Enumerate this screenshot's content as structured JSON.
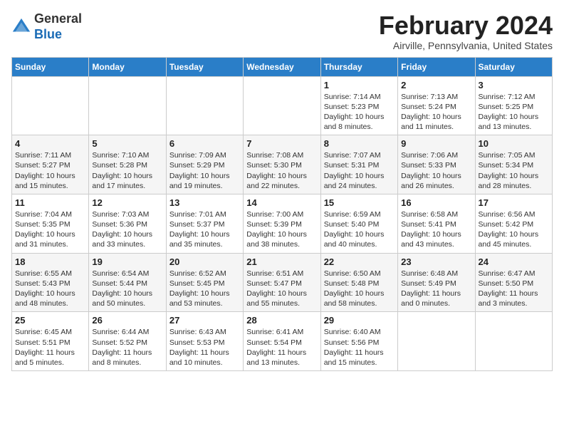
{
  "header": {
    "logo_line1": "General",
    "logo_line2": "Blue",
    "month": "February 2024",
    "location": "Airville, Pennsylvania, United States"
  },
  "weekdays": [
    "Sunday",
    "Monday",
    "Tuesday",
    "Wednesday",
    "Thursday",
    "Friday",
    "Saturday"
  ],
  "weeks": [
    [
      {
        "day": "",
        "info": ""
      },
      {
        "day": "",
        "info": ""
      },
      {
        "day": "",
        "info": ""
      },
      {
        "day": "",
        "info": ""
      },
      {
        "day": "1",
        "info": "Sunrise: 7:14 AM\nSunset: 5:23 PM\nDaylight: 10 hours\nand 8 minutes."
      },
      {
        "day": "2",
        "info": "Sunrise: 7:13 AM\nSunset: 5:24 PM\nDaylight: 10 hours\nand 11 minutes."
      },
      {
        "day": "3",
        "info": "Sunrise: 7:12 AM\nSunset: 5:25 PM\nDaylight: 10 hours\nand 13 minutes."
      }
    ],
    [
      {
        "day": "4",
        "info": "Sunrise: 7:11 AM\nSunset: 5:27 PM\nDaylight: 10 hours\nand 15 minutes."
      },
      {
        "day": "5",
        "info": "Sunrise: 7:10 AM\nSunset: 5:28 PM\nDaylight: 10 hours\nand 17 minutes."
      },
      {
        "day": "6",
        "info": "Sunrise: 7:09 AM\nSunset: 5:29 PM\nDaylight: 10 hours\nand 19 minutes."
      },
      {
        "day": "7",
        "info": "Sunrise: 7:08 AM\nSunset: 5:30 PM\nDaylight: 10 hours\nand 22 minutes."
      },
      {
        "day": "8",
        "info": "Sunrise: 7:07 AM\nSunset: 5:31 PM\nDaylight: 10 hours\nand 24 minutes."
      },
      {
        "day": "9",
        "info": "Sunrise: 7:06 AM\nSunset: 5:33 PM\nDaylight: 10 hours\nand 26 minutes."
      },
      {
        "day": "10",
        "info": "Sunrise: 7:05 AM\nSunset: 5:34 PM\nDaylight: 10 hours\nand 28 minutes."
      }
    ],
    [
      {
        "day": "11",
        "info": "Sunrise: 7:04 AM\nSunset: 5:35 PM\nDaylight: 10 hours\nand 31 minutes."
      },
      {
        "day": "12",
        "info": "Sunrise: 7:03 AM\nSunset: 5:36 PM\nDaylight: 10 hours\nand 33 minutes."
      },
      {
        "day": "13",
        "info": "Sunrise: 7:01 AM\nSunset: 5:37 PM\nDaylight: 10 hours\nand 35 minutes."
      },
      {
        "day": "14",
        "info": "Sunrise: 7:00 AM\nSunset: 5:39 PM\nDaylight: 10 hours\nand 38 minutes."
      },
      {
        "day": "15",
        "info": "Sunrise: 6:59 AM\nSunset: 5:40 PM\nDaylight: 10 hours\nand 40 minutes."
      },
      {
        "day": "16",
        "info": "Sunrise: 6:58 AM\nSunset: 5:41 PM\nDaylight: 10 hours\nand 43 minutes."
      },
      {
        "day": "17",
        "info": "Sunrise: 6:56 AM\nSunset: 5:42 PM\nDaylight: 10 hours\nand 45 minutes."
      }
    ],
    [
      {
        "day": "18",
        "info": "Sunrise: 6:55 AM\nSunset: 5:43 PM\nDaylight: 10 hours\nand 48 minutes."
      },
      {
        "day": "19",
        "info": "Sunrise: 6:54 AM\nSunset: 5:44 PM\nDaylight: 10 hours\nand 50 minutes."
      },
      {
        "day": "20",
        "info": "Sunrise: 6:52 AM\nSunset: 5:45 PM\nDaylight: 10 hours\nand 53 minutes."
      },
      {
        "day": "21",
        "info": "Sunrise: 6:51 AM\nSunset: 5:47 PM\nDaylight: 10 hours\nand 55 minutes."
      },
      {
        "day": "22",
        "info": "Sunrise: 6:50 AM\nSunset: 5:48 PM\nDaylight: 10 hours\nand 58 minutes."
      },
      {
        "day": "23",
        "info": "Sunrise: 6:48 AM\nSunset: 5:49 PM\nDaylight: 11 hours\nand 0 minutes."
      },
      {
        "day": "24",
        "info": "Sunrise: 6:47 AM\nSunset: 5:50 PM\nDaylight: 11 hours\nand 3 minutes."
      }
    ],
    [
      {
        "day": "25",
        "info": "Sunrise: 6:45 AM\nSunset: 5:51 PM\nDaylight: 11 hours\nand 5 minutes."
      },
      {
        "day": "26",
        "info": "Sunrise: 6:44 AM\nSunset: 5:52 PM\nDaylight: 11 hours\nand 8 minutes."
      },
      {
        "day": "27",
        "info": "Sunrise: 6:43 AM\nSunset: 5:53 PM\nDaylight: 11 hours\nand 10 minutes."
      },
      {
        "day": "28",
        "info": "Sunrise: 6:41 AM\nSunset: 5:54 PM\nDaylight: 11 hours\nand 13 minutes."
      },
      {
        "day": "29",
        "info": "Sunrise: 6:40 AM\nSunset: 5:56 PM\nDaylight: 11 hours\nand 15 minutes."
      },
      {
        "day": "",
        "info": ""
      },
      {
        "day": "",
        "info": ""
      }
    ]
  ]
}
